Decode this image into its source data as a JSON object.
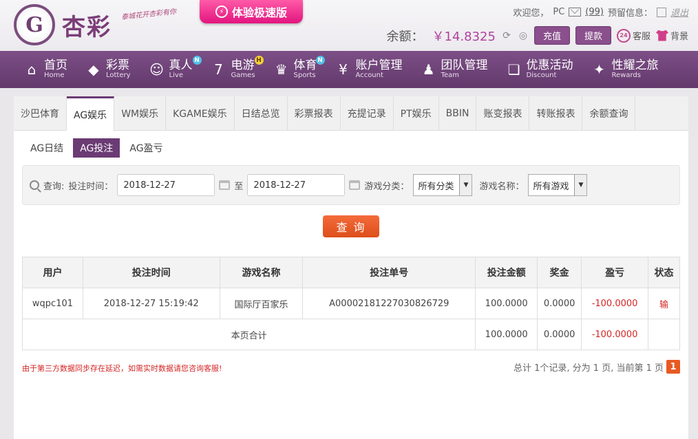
{
  "header": {
    "logo_text": "杏彩",
    "logo_mark": "G",
    "slogan": "泰城花开杏彩有你",
    "speed_badge": "体验极速版",
    "welcome": "欢迎您，",
    "username": "PC",
    "msg_count": "(99)",
    "warning_label": "预留信息：",
    "logout": "退出",
    "balance_label": "余额：",
    "balance_value": "￥14.8325",
    "deposit": "充值",
    "withdraw": "提款",
    "service": "客服",
    "service_badge": "24",
    "background": "背景"
  },
  "nav": [
    {
      "zh": "首页",
      "en": "Home",
      "icon": "home-icon"
    },
    {
      "zh": "彩票",
      "en": "Lottery",
      "icon": "lottery-icon"
    },
    {
      "zh": "真人",
      "en": "Live",
      "icon": "live-icon",
      "badge": "N"
    },
    {
      "zh": "电游",
      "en": "Games",
      "icon": "games-icon",
      "badge": "H"
    },
    {
      "zh": "体育",
      "en": "Sports",
      "icon": "sports-icon",
      "badge": "N"
    },
    {
      "zh": "账户管理",
      "en": "Account",
      "icon": "account-icon"
    },
    {
      "zh": "团队管理",
      "en": "Team",
      "icon": "team-icon"
    },
    {
      "zh": "优惠活动",
      "en": "Discount",
      "icon": "gift-icon"
    },
    {
      "zh": "性耀之旅",
      "en": "Rewards",
      "icon": "rewards-icon"
    }
  ],
  "tabs": [
    "沙巴体育",
    "AG娱乐",
    "WM娱乐",
    "KGAME娱乐",
    "日结总览",
    "彩票报表",
    "充提记录",
    "PT娱乐",
    "BBIN",
    "账变报表",
    "转账报表",
    "余额查询"
  ],
  "active_tab": "AG娱乐",
  "subtabs": [
    "AG日结",
    "AG投注",
    "AG盈亏"
  ],
  "active_subtab": "AG投注",
  "query": {
    "query_label": "查询:",
    "time_label": "投注时间：",
    "date_from": "2018-12-27",
    "to_label": "至",
    "date_to": "2018-12-27",
    "category_label": "游戏分类：",
    "category_value": "所有分类",
    "game_label": "游戏名称：",
    "game_value": "所有游戏",
    "submit": "查 询"
  },
  "table": {
    "headers": [
      "用户",
      "投注时间",
      "游戏名称",
      "投注单号",
      "投注金额",
      "奖金",
      "盈亏",
      "状态"
    ],
    "row": {
      "user": "wqpc101",
      "time": "2018-12-27 15:19:42",
      "game": "国际厅百家乐",
      "order": "A00002181227030826729",
      "amount": "100.0000",
      "bonus": "0.0000",
      "profit": "-100.0000",
      "status": "输"
    },
    "summary": {
      "label": "本页合计",
      "amount": "100.0000",
      "bonus": "0.0000",
      "profit": "-100.0000"
    }
  },
  "notice": "由于第三方数据同步存在延迟，如需实时数据请您咨询客服!",
  "pager": {
    "text": "总计 1个记录, 分为 1 页, 当前第 1 页",
    "current": "1"
  },
  "colors": {
    "nav": "#6b3f74",
    "accent": "#b0429c",
    "query_button": "#e85a22",
    "loss": "#d52525"
  }
}
